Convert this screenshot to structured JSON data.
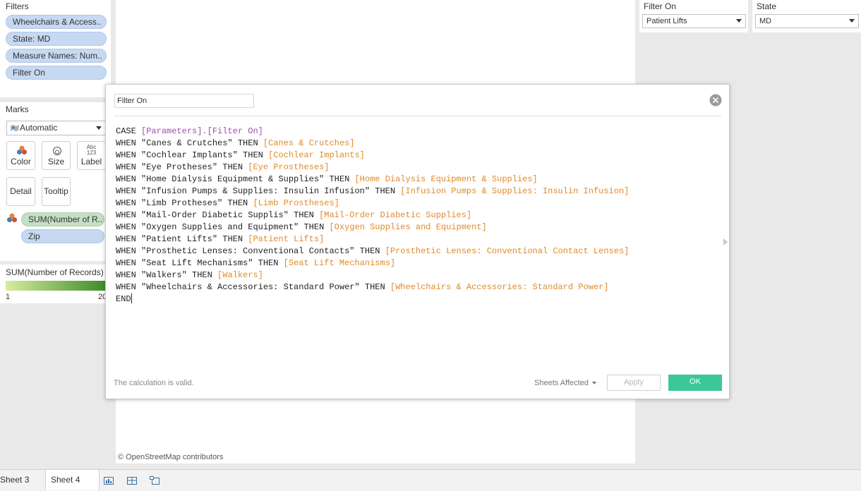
{
  "filters": {
    "title": "Filters",
    "items": [
      "Wheelchairs & Access..",
      "State: MD",
      "Measure Names: Num..",
      "Filter On"
    ]
  },
  "marks": {
    "title": "Marks",
    "type_label": "Automatic",
    "buttons": [
      "Color",
      "Size",
      "Label",
      "Detail",
      "Tooltip"
    ],
    "label_icon_text": "Abc\n123",
    "fields": [
      "SUM(Number of R..",
      "Zip"
    ]
  },
  "legend": {
    "title": "SUM(Number of Records)",
    "min": "1",
    "max": "20",
    "colors": {
      "start": "#d9ec9f",
      "end": "#3b8a2a"
    }
  },
  "parameters": {
    "filter_on": {
      "title": "Filter On",
      "value": "Patient Lifts"
    },
    "state": {
      "title": "State",
      "value": "MD"
    }
  },
  "map": {
    "attribution": "© OpenStreetMap contributors"
  },
  "dialog": {
    "name": "Filter On",
    "status": "The calculation is valid.",
    "sheets_affected": "Sheets Affected",
    "apply": "Apply",
    "ok": "OK",
    "code": [
      [
        {
          "t": "kw",
          "v": "CASE "
        },
        {
          "t": "param",
          "v": "[Parameters].[Filter On]"
        }
      ],
      [
        {
          "t": "kw",
          "v": "WHEN "
        },
        {
          "t": "str",
          "v": "\"Canes & Crutches\""
        },
        {
          "t": "kw",
          "v": " THEN "
        },
        {
          "t": "field",
          "v": "[Canes & Crutches]"
        }
      ],
      [
        {
          "t": "kw",
          "v": "WHEN "
        },
        {
          "t": "str",
          "v": "\"Cochlear Implants\""
        },
        {
          "t": "kw",
          "v": " THEN "
        },
        {
          "t": "field",
          "v": "[Cochlear Implants]"
        }
      ],
      [
        {
          "t": "kw",
          "v": "WHEN "
        },
        {
          "t": "str",
          "v": "\"Eye Protheses\""
        },
        {
          "t": "kw",
          "v": " THEN "
        },
        {
          "t": "field",
          "v": "[Eye Prostheses]"
        }
      ],
      [
        {
          "t": "kw",
          "v": "WHEN "
        },
        {
          "t": "str",
          "v": "\"Home Dialysis Equipment & Supplies\""
        },
        {
          "t": "kw",
          "v": " THEN "
        },
        {
          "t": "field",
          "v": "[Home Dialysis Equipment & Supplies]"
        }
      ],
      [
        {
          "t": "kw",
          "v": "WHEN "
        },
        {
          "t": "str",
          "v": "\"Infusion Pumps & Supplies: Insulin Infusion\""
        },
        {
          "t": "kw",
          "v": " THEN "
        },
        {
          "t": "field",
          "v": "[Infusion Pumps & Supplies: Insulin Infusion]"
        }
      ],
      [
        {
          "t": "kw",
          "v": "WHEN "
        },
        {
          "t": "str",
          "v": "\"Limb Protheses\""
        },
        {
          "t": "kw",
          "v": " THEN "
        },
        {
          "t": "field",
          "v": "[Limb Prostheses]"
        }
      ],
      [
        {
          "t": "kw",
          "v": "WHEN "
        },
        {
          "t": "str",
          "v": "\"Mail-Order Diabetic Supplis\""
        },
        {
          "t": "kw",
          "v": " THEN "
        },
        {
          "t": "field",
          "v": "[Mail-Order Diabetic Supplies]"
        }
      ],
      [
        {
          "t": "kw",
          "v": "WHEN "
        },
        {
          "t": "str",
          "v": "\"Oxygen Supplies and Equipment\""
        },
        {
          "t": "kw",
          "v": " THEN "
        },
        {
          "t": "field",
          "v": "[Oxygen Supplies and Equipment]"
        }
      ],
      [
        {
          "t": "kw",
          "v": "WHEN "
        },
        {
          "t": "str",
          "v": "\"Patient Lifts\""
        },
        {
          "t": "kw",
          "v": " THEN "
        },
        {
          "t": "field",
          "v": "[Patient Lifts]"
        }
      ],
      [
        {
          "t": "kw",
          "v": "WHEN "
        },
        {
          "t": "str",
          "v": "\"Prosthetic Lenses: Conventional Contacts\""
        },
        {
          "t": "kw",
          "v": " THEN "
        },
        {
          "t": "field",
          "v": "[Prosthetic Lenses: Conventional Contact Lenses]"
        }
      ],
      [
        {
          "t": "kw",
          "v": "WHEN "
        },
        {
          "t": "str",
          "v": "\"Seat Lift Mechanisms\""
        },
        {
          "t": "kw",
          "v": " THEN "
        },
        {
          "t": "field",
          "v": "[Seat Lift Mechanisms]"
        }
      ],
      [
        {
          "t": "kw",
          "v": "WHEN "
        },
        {
          "t": "str",
          "v": "\"Walkers\""
        },
        {
          "t": "kw",
          "v": " THEN "
        },
        {
          "t": "field",
          "v": "[Walkers]"
        }
      ],
      [
        {
          "t": "kw",
          "v": "WHEN "
        },
        {
          "t": "str",
          "v": "\"Wheelchairs & Accessories: Standard Power\""
        },
        {
          "t": "kw",
          "v": " THEN "
        },
        {
          "t": "field",
          "v": "[Wheelchairs & Accessories: Standard Power]"
        }
      ],
      [
        {
          "t": "kw",
          "v": "END"
        }
      ]
    ],
    "colors": {
      "ok": "#3cc79a",
      "field": "#e08a2c",
      "param": "#a24bb3"
    }
  },
  "tabs": [
    "Sheet 3",
    "Sheet 4"
  ]
}
